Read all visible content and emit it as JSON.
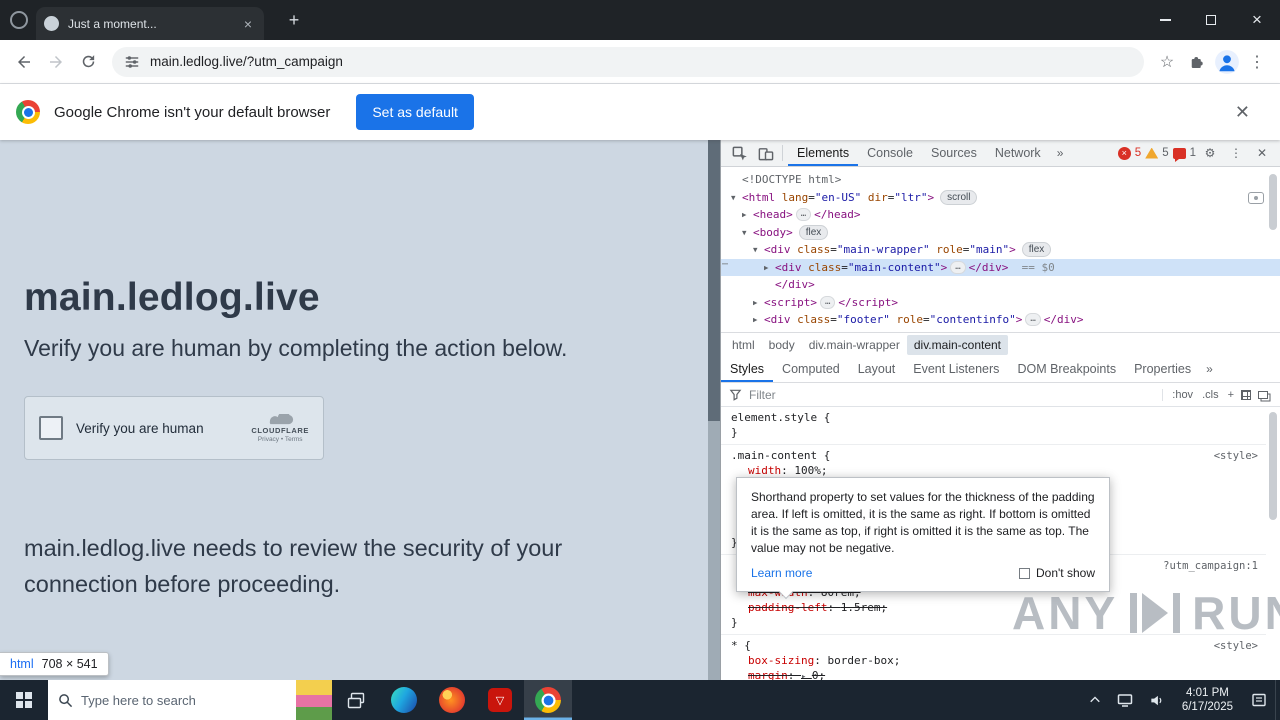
{
  "browser": {
    "tab_title": "Just a moment...",
    "url": "main.ledlog.live/?utm_campaign",
    "banner_text": "Google Chrome isn't your default browser",
    "banner_button": "Set as default"
  },
  "page": {
    "heading": "main.ledlog.live",
    "subheading": "Verify you are human by completing the action below.",
    "widget": {
      "label": "Verify you are human",
      "brand": "CLOUDFLARE",
      "privacy": "Privacy",
      "terms": "Terms",
      "links_sep": "•"
    },
    "paragraph": "main.ledlog.live needs to review the security of your connection before proceeding.",
    "inspect_tooltip": {
      "tag": "html",
      "dims": "708 × 541"
    }
  },
  "devtools": {
    "tabs": [
      {
        "label": "Elements",
        "active": true
      },
      {
        "label": "Console"
      },
      {
        "label": "Sources"
      },
      {
        "label": "Network"
      }
    ],
    "more_tabs": "»",
    "counters": {
      "errors": "5",
      "warnings": "5",
      "issues": "1"
    },
    "dom_lines": [
      {
        "indent": 0,
        "arrow": "",
        "tokens": [
          {
            "c": "doc",
            "s": "<!DOCTYPE html>"
          }
        ]
      },
      {
        "indent": 0,
        "arrow": "down",
        "right_icon": true,
        "badges": [
          "scroll"
        ],
        "tokens": [
          {
            "c": "tag",
            "s": "<html"
          },
          {
            "c": "attr",
            "s": " lang"
          },
          {
            "c": "pun",
            "s": "="
          },
          {
            "c": "val",
            "s": "\"en-US\""
          },
          {
            "c": "attr",
            "s": " dir"
          },
          {
            "c": "pun",
            "s": "="
          },
          {
            "c": "val",
            "s": "\"ltr\""
          },
          {
            "c": "tag",
            "s": ">"
          }
        ]
      },
      {
        "indent": 1,
        "arrow": "right",
        "tokens": [
          {
            "c": "tag",
            "s": "<head>"
          },
          {
            "c": "ell",
            "s": "…"
          },
          {
            "c": "tag",
            "s": "</head>"
          }
        ]
      },
      {
        "indent": 1,
        "arrow": "down",
        "badges": [
          "flex"
        ],
        "tokens": [
          {
            "c": "tag",
            "s": "<body>"
          }
        ]
      },
      {
        "indent": 2,
        "arrow": "down",
        "badges": [
          "flex"
        ],
        "tokens": [
          {
            "c": "tag",
            "s": "<div"
          },
          {
            "c": "attr",
            "s": " class"
          },
          {
            "c": "pun",
            "s": "="
          },
          {
            "c": "val",
            "s": "\"main-wrapper\""
          },
          {
            "c": "attr",
            "s": " role"
          },
          {
            "c": "pun",
            "s": "="
          },
          {
            "c": "val",
            "s": "\"main\""
          },
          {
            "c": "tag",
            "s": ">"
          }
        ]
      },
      {
        "indent": 3,
        "arrow": "right",
        "selected": true,
        "gutter": "⋯",
        "tokens": [
          {
            "c": "tag",
            "s": "<div"
          },
          {
            "c": "attr",
            "s": " class"
          },
          {
            "c": "pun",
            "s": "="
          },
          {
            "c": "val",
            "s": "\"main-content\""
          },
          {
            "c": "tag",
            "s": ">"
          },
          {
            "c": "ell",
            "s": "…"
          },
          {
            "c": "tag",
            "s": "</div>"
          },
          {
            "c": "eq",
            "s": "  == $0"
          }
        ]
      },
      {
        "indent": 3,
        "arrow": "",
        "tokens": [
          {
            "c": "tag",
            "s": "</div>"
          }
        ]
      },
      {
        "indent": 2,
        "arrow": "right",
        "tokens": [
          {
            "c": "tag",
            "s": "<script>"
          },
          {
            "c": "ell",
            "s": "…"
          },
          {
            "c": "tag",
            "s": "</script>"
          }
        ]
      },
      {
        "indent": 2,
        "arrow": "right",
        "tokens": [
          {
            "c": "tag",
            "s": "<div"
          },
          {
            "c": "attr",
            "s": " class"
          },
          {
            "c": "pun",
            "s": "="
          },
          {
            "c": "val",
            "s": "\"footer\""
          },
          {
            "c": "attr",
            "s": " role"
          },
          {
            "c": "pun",
            "s": "="
          },
          {
            "c": "val",
            "s": "\"contentinfo\""
          },
          {
            "c": "tag",
            "s": ">"
          },
          {
            "c": "ell",
            "s": "…"
          },
          {
            "c": "tag",
            "s": "</div>"
          }
        ]
      }
    ],
    "breadcrumbs": [
      {
        "label": "html"
      },
      {
        "label": "body"
      },
      {
        "label": "div.main-wrapper"
      },
      {
        "label": "div.main-content",
        "selected": true
      }
    ],
    "sidebar_tabs": [
      {
        "label": "Styles",
        "active": true
      },
      {
        "label": "Computed"
      },
      {
        "label": "Layout"
      },
      {
        "label": "Event Listeners"
      },
      {
        "label": "DOM Breakpoints"
      },
      {
        "label": "Properties"
      }
    ],
    "sidebar_more": "»",
    "filter_placeholder": "Filter",
    "toggles": [
      ":hov",
      ".cls",
      "+"
    ],
    "style_rules": [
      {
        "selector": "element.style {",
        "props": [],
        "close": "}"
      },
      {
        "selector": ".main-content {",
        "link": "<style>",
        "props": [
          {
            "name": "width",
            "value": "100%"
          }
        ],
        "spacer": 57,
        "close": "}"
      },
      {
        "selector": "",
        "link": "?utm_campaign:1",
        "spacer_after_head": 12,
        "props": [
          {
            "name": "max-width",
            "value": "80rem",
            "struck": true
          },
          {
            "name": "padding-left",
            "value": "1.5rem",
            "struck": true
          }
        ],
        "close": "}"
      },
      {
        "selector": "* {",
        "link": "<style>",
        "props": [
          {
            "name": "box-sizing",
            "value": "border-box"
          },
          {
            "name": "margin",
            "value": "0",
            "struck": true,
            "expand": true
          }
        ],
        "close": "}"
      }
    ],
    "tooltip": {
      "text": "Shorthand property to set values for the thickness of the padding area. If left is omitted, it is the same as right. If bottom is omitted it is the same as top, if right is omitted it is the same as top. The value may not be negative.",
      "learn_more": "Learn more",
      "dont_show": "Don't show"
    }
  },
  "taskbar": {
    "search_placeholder": "Type here to search",
    "time": "4:01 PM",
    "date": "6/17/2025"
  },
  "watermark": {
    "left": "ANY",
    "right": "RUN"
  }
}
